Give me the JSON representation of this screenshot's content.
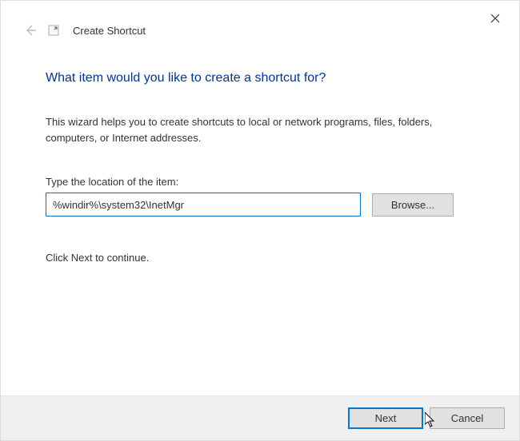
{
  "header": {
    "wizard_title": "Create Shortcut"
  },
  "content": {
    "main_heading": "What item would you like to create a shortcut for?",
    "description": "This wizard helps you to create shortcuts to local or network programs, files, folders, computers, or Internet addresses.",
    "input_label": "Type the location of the item:",
    "location_value": "%windir%\\system32\\InetMgr",
    "browse_label": "Browse...",
    "continue_text": "Click Next to continue."
  },
  "footer": {
    "next_label": "Next",
    "cancel_label": "Cancel"
  }
}
